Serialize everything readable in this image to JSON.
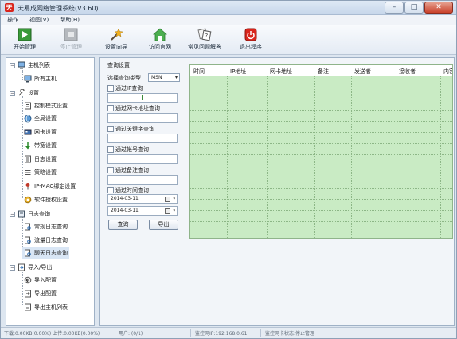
{
  "window": {
    "title": "天易成网络管理系统(V3.60)",
    "controls": {
      "minimize": "–",
      "maximize": "□",
      "close": "✕"
    }
  },
  "menubar": [
    "操作",
    "视图(V)",
    "帮助(H)"
  ],
  "toolbar": [
    {
      "label": "开始管理",
      "icon": "start-manage-icon",
      "enabled": true
    },
    {
      "label": "停止管理",
      "icon": "stop-manage-icon",
      "enabled": false
    },
    {
      "label": "设置向导",
      "icon": "wizard-icon",
      "enabled": true
    },
    {
      "label": "访问官网",
      "icon": "home-icon",
      "enabled": true
    },
    {
      "label": "常见问题解答",
      "icon": "faq-icon",
      "enabled": true
    },
    {
      "label": "退出程序",
      "icon": "power-icon",
      "enabled": true
    }
  ],
  "tree": {
    "groups": [
      {
        "label": "主机列表",
        "expanded": true,
        "children": [
          "所有主机"
        ]
      },
      {
        "label": "设置",
        "expanded": true,
        "children": [
          "控制模式设置",
          "全局设置",
          "网卡设置",
          "带宽设置",
          "日志设置",
          "策略设置",
          "IP-MAC绑定设置",
          "软件授权设置"
        ]
      },
      {
        "label": "日志查询",
        "expanded": true,
        "children": [
          "常规日志查询",
          "流量日志查询",
          "聊天日志查询"
        ]
      },
      {
        "label": "导入/导出",
        "expanded": true,
        "children": [
          "导入配置",
          "导出配置",
          "导出主机列表"
        ]
      }
    ],
    "selected": "聊天日志查询"
  },
  "query": {
    "title": "查询设置",
    "type_label": "选择查询类型",
    "type_value": "MSN",
    "filters": {
      "ip": "通过IP查询",
      "mac": "通过网卡地址查询",
      "keyword": "通过关键字查询",
      "account": "通过帐号查询",
      "note": "通过备注查询",
      "time": "通过时间查询"
    },
    "date_from": "2014-03-11",
    "date_to": "2014-03-11",
    "query_button": "查询",
    "export_button": "导出"
  },
  "grid": {
    "columns": [
      "时间",
      "IP地址",
      "网卡地址",
      "备注",
      "发送者",
      "接收者",
      "内容"
    ]
  },
  "status": {
    "traffic": "下载:0.00KB(0.00%) 上传:0.00KB(0.00%)",
    "users": "用户: (0/1)",
    "monitor_ip": "监控网IP:192.168.0.61",
    "monitor_state": "监控网卡状态:停止管理"
  },
  "colors": {
    "grid_bg": "#c9ebc4",
    "accent": "#d9251c"
  }
}
